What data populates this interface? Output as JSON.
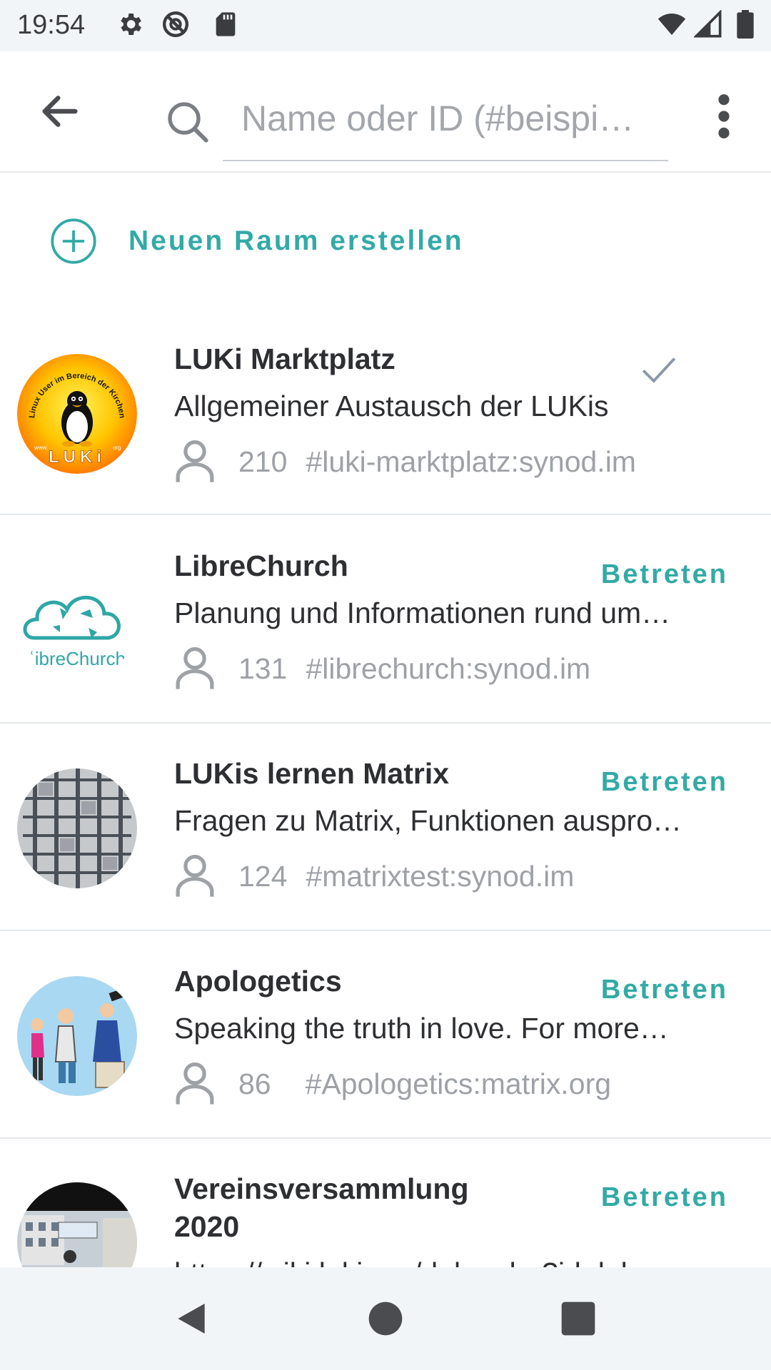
{
  "status": {
    "time": "19:54",
    "icons": [
      "gear-icon",
      "no-disturb-icon",
      "sd-card-icon",
      "wifi-icon",
      "signal-icon",
      "battery-icon"
    ]
  },
  "header": {
    "search_placeholder": "Name oder ID (#beispi…",
    "icons": [
      "back-arrow-icon",
      "search-icon",
      "more-vert-icon"
    ]
  },
  "create_room": {
    "label": "Neuen Raum erstellen",
    "icon": "plus-circle-icon"
  },
  "colors": {
    "accent": "#33aaa6",
    "text": "#2e2f32",
    "muted": "#9ea1a6"
  },
  "rooms": [
    {
      "name": "LUKi Marktplatz",
      "topic": "Allgemeiner Austausch der LUKis",
      "members": "210",
      "alias": "#luki-marktplatz:synod.im",
      "joined": true,
      "action": "",
      "avatar_text": {
        "ring": "Linux User im Bereich der Kirchen",
        "word": "LUKi",
        "url": "www.",
        "org": "org"
      }
    },
    {
      "name": "LibreChurch",
      "topic": "Planung und Informationen rund um…",
      "members": "131",
      "alias": "#librechurch:synod.im",
      "joined": false,
      "action": "Betreten",
      "avatar_text": {
        "word": "ʿibreChurch"
      }
    },
    {
      "name": "LUKis lernen Matrix",
      "topic": "Fragen zu Matrix, Funktionen auspro…",
      "members": "124",
      "alias": "#matrixtest:synod.im",
      "joined": false,
      "action": "Betreten"
    },
    {
      "name": "Apologetics",
      "topic": "Speaking the truth in love.  For more…",
      "members": "86",
      "alias": "#Apologetics:matrix.org",
      "joined": false,
      "action": "Betreten"
    },
    {
      "name_line1": "Vereinsversammlung",
      "name_line2": "2020",
      "topic": "https://wiki.luki.org/doku.php?id=luk…",
      "joined": false,
      "action": "Betreten"
    }
  ],
  "nav": {
    "icons": [
      "back-triangle-icon",
      "home-circle-icon",
      "recents-square-icon"
    ]
  }
}
